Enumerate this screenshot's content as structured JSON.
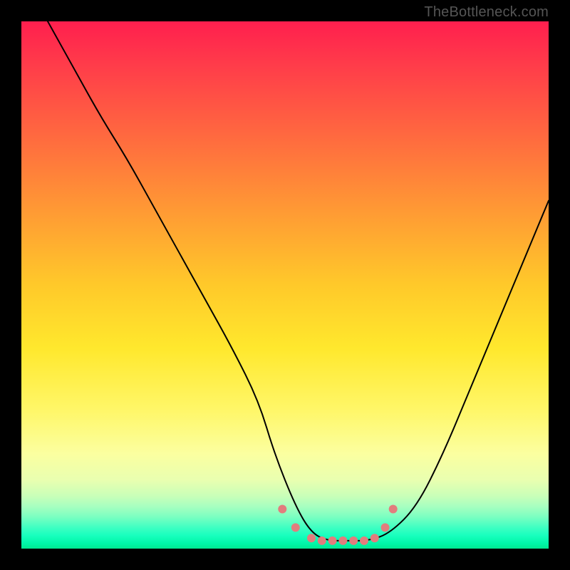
{
  "watermark": "TheBottleneck.com",
  "chart_data": {
    "type": "line",
    "title": "",
    "xlabel": "",
    "ylabel": "",
    "xlim": [
      0,
      100
    ],
    "ylim": [
      0,
      100
    ],
    "grid": false,
    "legend": false,
    "gradient_stops": [
      {
        "pos": 0,
        "color": "#ff1f4e"
      },
      {
        "pos": 22,
        "color": "#ff6a3f"
      },
      {
        "pos": 50,
        "color": "#ffc92a"
      },
      {
        "pos": 74,
        "color": "#fff76a"
      },
      {
        "pos": 90,
        "color": "#c9ffb8"
      },
      {
        "pos": 100,
        "color": "#00e890"
      }
    ],
    "series": [
      {
        "name": "bottleneck-curve",
        "stroke": "#000000",
        "stroke_width": 2,
        "x": [
          5,
          10,
          15,
          20,
          25,
          30,
          35,
          40,
          45,
          48,
          52,
          55,
          58,
          62,
          66,
          70,
          75,
          80,
          85,
          90,
          95,
          100
        ],
        "y": [
          100,
          91,
          82,
          74,
          65,
          56,
          47,
          38,
          28,
          18,
          8,
          3,
          1.5,
          1.5,
          1.5,
          3,
          8,
          18,
          30,
          42,
          54,
          66
        ]
      },
      {
        "name": "marker-dots",
        "type": "scatter",
        "color": "#e27d7d",
        "radius": 6,
        "x": [
          49.5,
          52,
          55,
          57,
          59,
          61,
          63,
          65,
          67,
          69,
          70.5
        ],
        "y": [
          7.5,
          4,
          2,
          1.5,
          1.5,
          1.5,
          1.5,
          1.5,
          2,
          4,
          7.5
        ]
      }
    ]
  }
}
